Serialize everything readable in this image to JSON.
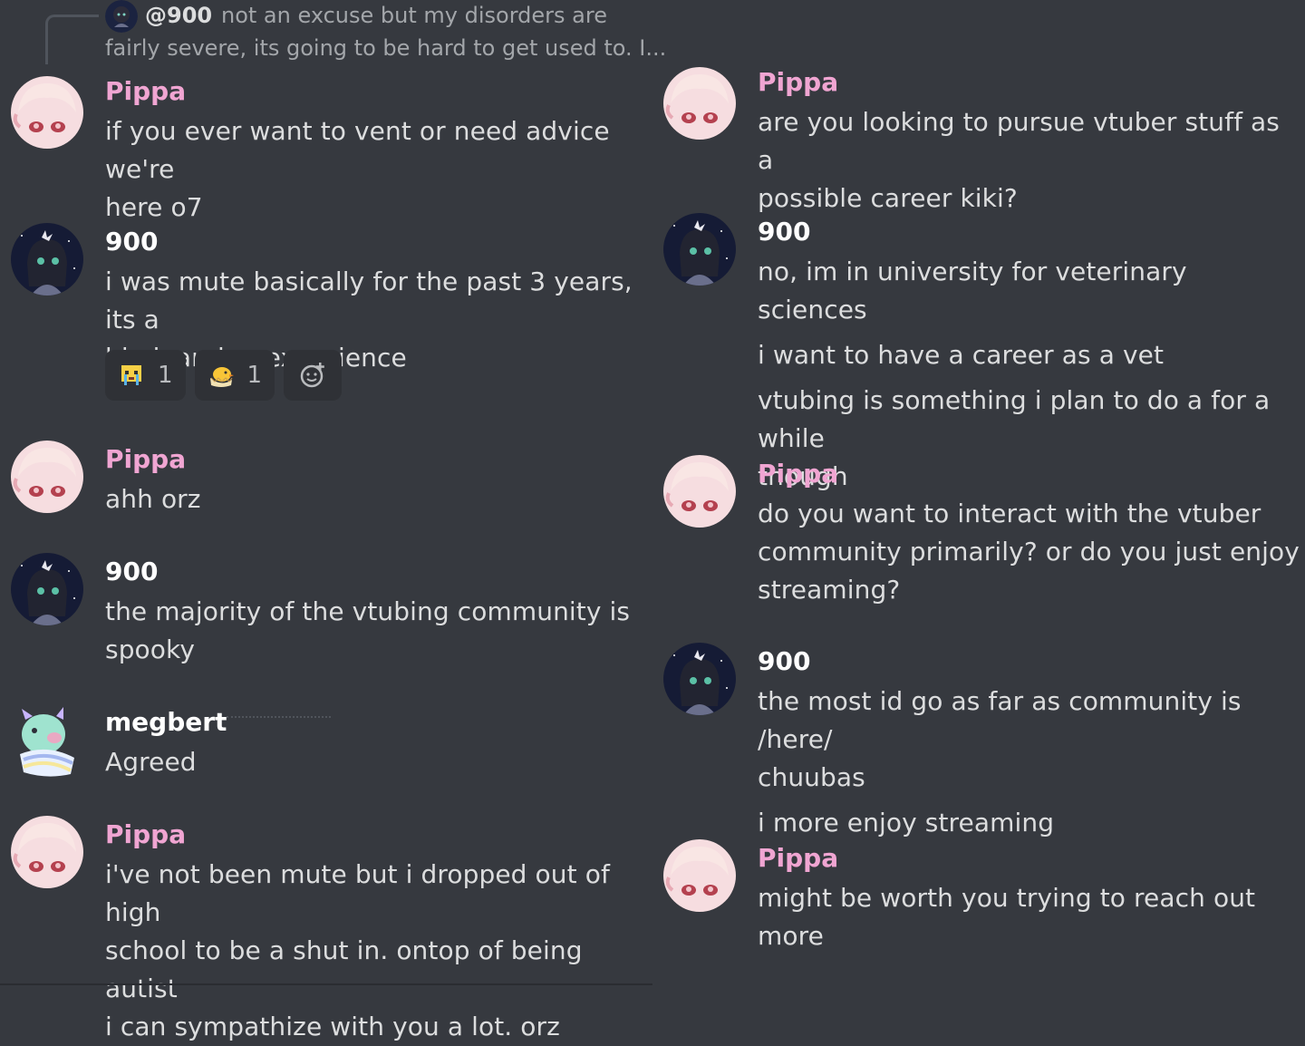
{
  "left": {
    "reply": {
      "username": "@900",
      "text_line1": "not an excuse but my disorders are",
      "text_line2": "fairly severe, its going to be hard to get used to. I..."
    },
    "messages": [
      {
        "username": "Pippa",
        "lines": [
          "if you ever want to vent or need advice we're",
          "here o7"
        ]
      },
      {
        "username": "900",
        "lines": [
          "i was mute basically for the past 3 years, its a",
          "big learning experience"
        ]
      },
      {
        "username": "Pippa",
        "lines": [
          "ahh orz"
        ]
      },
      {
        "username": "900",
        "lines": [
          "the majority of the vtubing community is",
          "spooky"
        ]
      },
      {
        "username": "megbert",
        "lines": [
          "Agreed"
        ]
      },
      {
        "username": "Pippa",
        "lines": [
          "i've not been mute but i dropped out of high",
          "school to be a shut in. ontop of being autist",
          "i can sympathize with you a lot. orz"
        ]
      }
    ],
    "reactions": [
      {
        "emoji": "crying-face-emoji",
        "count": "1"
      },
      {
        "emoji": "hatching-chick-emoji",
        "count": "1"
      },
      {
        "emoji": "add-reaction-icon",
        "count": ""
      }
    ]
  },
  "right": {
    "messages": [
      {
        "username": "Pippa",
        "lines": [
          "are you looking to pursue vtuber stuff as a",
          "possible career kiki?"
        ]
      },
      {
        "username": "900",
        "lines": [
          "no, im in university for veterinary sciences"
        ],
        "extra": [
          [
            "i want to have a career as a vet"
          ],
          [
            "vtubing is something i plan to do a for a while",
            "though"
          ]
        ]
      },
      {
        "username": "Pippa",
        "lines": [
          "do you want to interact with the vtuber",
          "community primarily? or do you just enjoy",
          "streaming?"
        ]
      },
      {
        "username": "900",
        "lines": [
          "the most id go as far as community is /here/",
          "chuubas"
        ],
        "extra": [
          [
            "i more enjoy streaming"
          ]
        ]
      },
      {
        "username": "Pippa",
        "lines": [
          "might be worth you trying to reach out more"
        ]
      }
    ]
  },
  "colors": {
    "background": "#36393f",
    "pippa_name": "#f0a5d2",
    "name_default": "#ffffff",
    "text": "#dcddde",
    "reaction_bg": "#2f3136"
  }
}
